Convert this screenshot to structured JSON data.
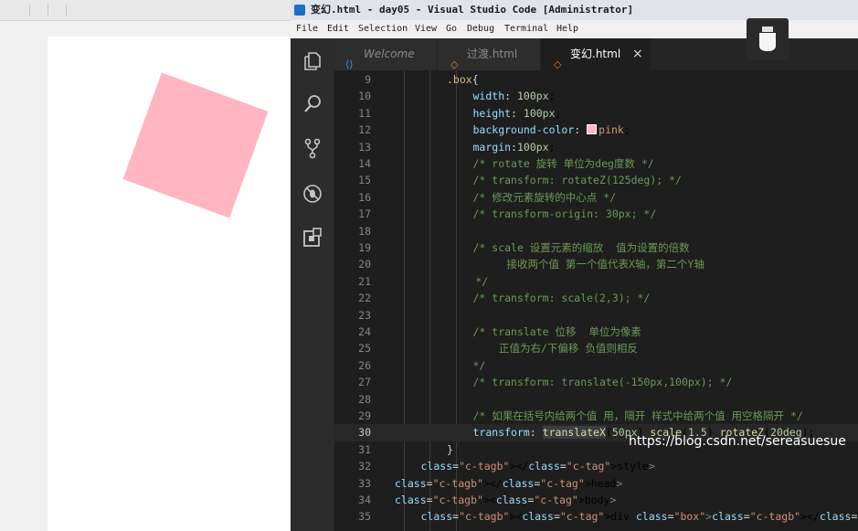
{
  "window": {
    "title": "变幻.html - day05 - Visual Studio Code [Administrator]"
  },
  "menu": [
    "File",
    "Edit",
    "Selection",
    "View",
    "Go",
    "Debug",
    "Terminal",
    "Help"
  ],
  "tabs": [
    {
      "label": "Welcome",
      "icon": "vscode-icon",
      "active": false
    },
    {
      "label": "过渡.html",
      "icon": "html-icon",
      "active": false
    },
    {
      "label": "变幻.html",
      "icon": "html-icon",
      "active": true,
      "close": "×"
    }
  ],
  "preview": {
    "box_color": "#ffb6c1",
    "box_rotation_deg": 20
  },
  "editor": {
    "current_line": "30",
    "lines": [
      {
        "n": "9",
        "code": ".box{"
      },
      {
        "n": "10",
        "code": "width: 100px;"
      },
      {
        "n": "11",
        "code": "height: 100px;"
      },
      {
        "n": "12",
        "code": "background-color: pink;"
      },
      {
        "n": "13",
        "code": "margin:100px;"
      },
      {
        "n": "14",
        "code": "/* rotate 旋转 单位为deg度数 */"
      },
      {
        "n": "15",
        "code": "/* transform: rotateZ(125deg); */"
      },
      {
        "n": "16",
        "code": "/* 修改元素旋转的中心点 */"
      },
      {
        "n": "17",
        "code": "/* transform-origin: 30px; */"
      },
      {
        "n": "18",
        "code": ""
      },
      {
        "n": "19",
        "code": "/* scale 设置元素的缩放  值为设置的倍数"
      },
      {
        "n": "20",
        "code": "接收两个值 第一个值代表X轴，第二个Y轴"
      },
      {
        "n": "21",
        "code": "*/"
      },
      {
        "n": "22",
        "code": "/* transform: scale(2,3); */"
      },
      {
        "n": "23",
        "code": ""
      },
      {
        "n": "24",
        "code": "/* translate 位移  单位为像素"
      },
      {
        "n": "25",
        "code": "正值为右/下偏移 负值则相反"
      },
      {
        "n": "26",
        "code": "*/"
      },
      {
        "n": "27",
        "code": "/* transform: translate(-150px,100px); */"
      },
      {
        "n": "28",
        "code": ""
      },
      {
        "n": "29",
        "code": "/* 如果在括号内给两个值 用，隔开 样式中给两个值 用空格隔开 */"
      },
      {
        "n": "30",
        "code": "transform: translateX(50px) scale(1.5) rotateZ(20deg);"
      },
      {
        "n": "31",
        "code": "}"
      },
      {
        "n": "32",
        "code": "</style>"
      },
      {
        "n": "33",
        "code": "</head>"
      },
      {
        "n": "34",
        "code": "<body>"
      },
      {
        "n": "35",
        "code": "<div class=\"box\"></div>"
      }
    ]
  },
  "watermark": "https://blog.csdn.net/sereasuesue",
  "colors": {
    "editor_bg": "#1e1e1e",
    "activity_bg": "#2c2c2c",
    "comment": "#6a9955",
    "property": "#9cdcfe",
    "number": "#b5cea8"
  }
}
